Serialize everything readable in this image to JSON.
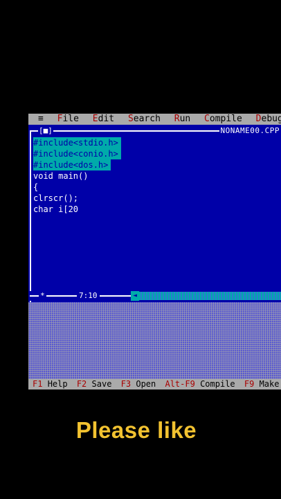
{
  "menu": {
    "system_icon": "≡",
    "items": [
      {
        "hot": "F",
        "rest": "ile"
      },
      {
        "hot": "E",
        "rest": "dit"
      },
      {
        "hot": "S",
        "rest": "earch"
      },
      {
        "hot": "R",
        "rest": "un"
      },
      {
        "hot": "C",
        "rest": "ompile"
      },
      {
        "hot": "D",
        "rest": "ebug"
      }
    ]
  },
  "editor": {
    "close_box": "[■]",
    "filename": "NONAME00.CPP",
    "lines": [
      {
        "text": "#include<stdio.h>",
        "selected": true
      },
      {
        "text": "#include<conio.h>",
        "selected": true
      },
      {
        "text": "#include<dos.h>",
        "selected": true
      },
      {
        "text": "void main()",
        "selected": false
      },
      {
        "text": "{",
        "selected": false
      },
      {
        "text": "clrscr();",
        "selected": false
      },
      {
        "text": "char i[20",
        "selected": false
      }
    ],
    "status_icon": "*",
    "cursor_position": "7:10",
    "scroll_arrow": "◄"
  },
  "function_keys": [
    {
      "key": "F1",
      "label": "Help"
    },
    {
      "key": "F2",
      "label": "Save"
    },
    {
      "key": "F3",
      "label": "Open"
    },
    {
      "key": "Alt-F9",
      "label": "Compile"
    },
    {
      "key": "F9",
      "label": "Make"
    }
  ],
  "caption": "Please like",
  "colors": {
    "editor_bg": "#0000a8",
    "selection": "#00aaaa",
    "menu_bg": "#aaaaaa",
    "hotkey": "#a80000",
    "caption": "#f2c230"
  }
}
